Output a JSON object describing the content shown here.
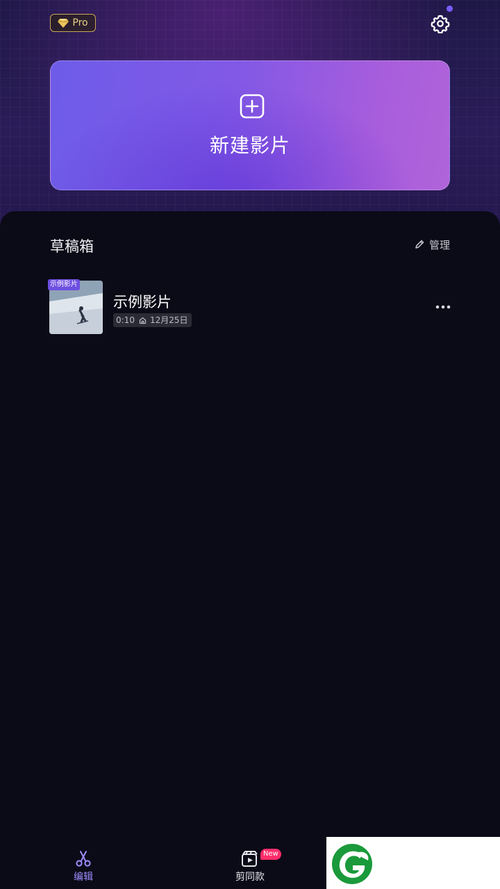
{
  "header": {
    "pro_badge": "Pro",
    "settings_icon": "gear-icon",
    "notification_dot_color": "#7a5cff"
  },
  "new_movie": {
    "label": "新建影片",
    "icon": "plus-square-icon"
  },
  "drafts": {
    "title": "草稿箱",
    "manage_label": "管理",
    "items": [
      {
        "tag": "示例影片",
        "title": "示例影片",
        "duration": "0:10",
        "date": "12月25日"
      }
    ]
  },
  "bottom_nav": {
    "tabs": [
      {
        "label": "编辑",
        "icon": "scissors-icon",
        "active": true
      },
      {
        "label": "剪同款",
        "icon": "film-play-icon",
        "badge": "New",
        "active": false
      }
    ]
  },
  "colors": {
    "accent": "#9f8cff",
    "card_start": "#6d5ce8",
    "card_end": "#b064da",
    "badge_new": "#ff2d6b",
    "background": "#0b0b17"
  }
}
